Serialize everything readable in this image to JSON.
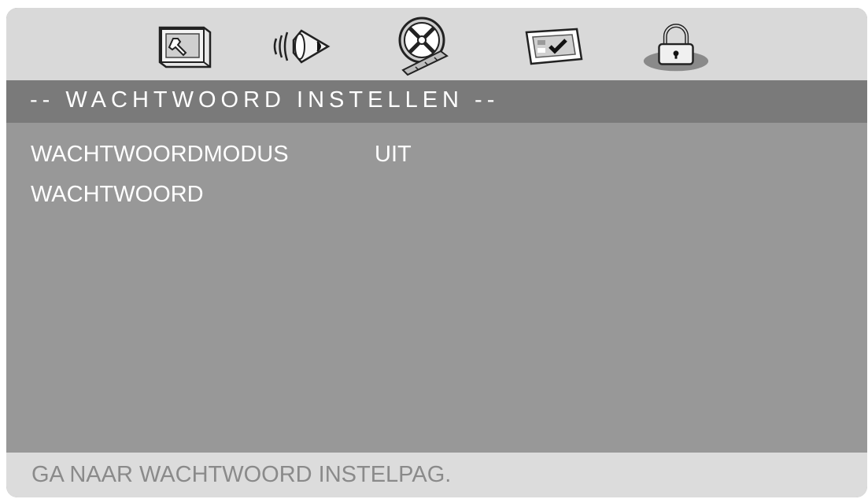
{
  "toolbar": {
    "icons": [
      {
        "name": "general-setup-icon"
      },
      {
        "name": "audio-setup-icon"
      },
      {
        "name": "video-setup-icon"
      },
      {
        "name": "preference-setup-icon"
      },
      {
        "name": "password-lock-icon",
        "selected": true
      }
    ]
  },
  "page": {
    "title": "-- WACHTWOORD INSTELLEN --"
  },
  "settings": {
    "rows": [
      {
        "label": "WACHTWOORDMODUS",
        "value": "UIT"
      },
      {
        "label": "WACHTWOORD",
        "value": ""
      }
    ]
  },
  "status": {
    "text": "GA NAAR WACHTWOORD INSTELPAG."
  },
  "colors": {
    "panel": "#989898",
    "title_bar": "#7a7a7a",
    "icon_bar": "#d9d9d9",
    "status_bar": "#dcdcdc",
    "text": "#ffffff",
    "status_text": "#8a8a8a"
  }
}
